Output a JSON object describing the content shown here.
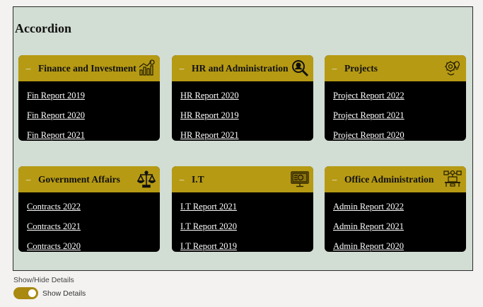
{
  "title": "Accordion",
  "cards": [
    {
      "title": "Finance and Investment",
      "toggle": "–",
      "icon": "finance-chart-icon",
      "links": [
        "Fin Report 2019",
        "Fin Report 2020",
        "Fin Report 2021"
      ]
    },
    {
      "title": "HR and Administration",
      "toggle": "–",
      "icon": "person-search-icon",
      "links": [
        "HR Report 2020",
        "HR Report 2019",
        "HR Report 2021"
      ]
    },
    {
      "title": "Projects",
      "toggle": "–",
      "icon": "gear-idea-icon",
      "links": [
        "Project Report 2022",
        "Project Report 2021",
        "Project Report 2020"
      ]
    },
    {
      "title": "Government Affairs",
      "toggle": "–",
      "icon": "scales-icon",
      "links": [
        "Contracts 2022",
        "Contracts 2021",
        "Contracts 2020"
      ]
    },
    {
      "title": "I.T",
      "toggle": "–",
      "icon": "monitor-icon",
      "links": [
        "I.T Report 2021",
        "I.T Report 2020",
        "I.T Report 2019"
      ]
    },
    {
      "title": "Office Administration",
      "toggle": "–",
      "icon": "desk-network-icon",
      "links": [
        "Admin Report 2022",
        "Admin Report 2021",
        "Admin Report 2020"
      ]
    }
  ],
  "footer": {
    "label": "Show/Hide Details",
    "toggle_label": "Show Details",
    "toggle_on": true
  },
  "colors": {
    "panel_bg": "#d2ddd3",
    "header_gold": "#b69a13",
    "card_body": "#000000",
    "toggle_accent": "#a98910"
  }
}
